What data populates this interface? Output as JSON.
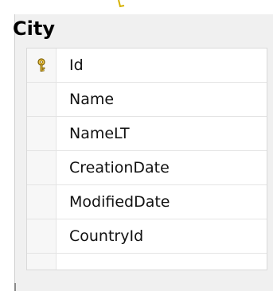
{
  "table": {
    "title": "City",
    "columns": [
      {
        "name": "Id",
        "icon": "key-icon",
        "is_primary_key": true
      },
      {
        "name": "Name",
        "icon": "",
        "is_primary_key": false
      },
      {
        "name": "NameLT",
        "icon": "",
        "is_primary_key": false
      },
      {
        "name": "CreationDate",
        "icon": "",
        "is_primary_key": false
      },
      {
        "name": "ModifiedDate",
        "icon": "",
        "is_primary_key": false
      },
      {
        "name": "CountryId",
        "icon": "",
        "is_primary_key": false
      }
    ]
  },
  "colors": {
    "key_fill": "#f2c94c",
    "key_stroke": "#7a5d00",
    "connector": "#d6b100"
  }
}
